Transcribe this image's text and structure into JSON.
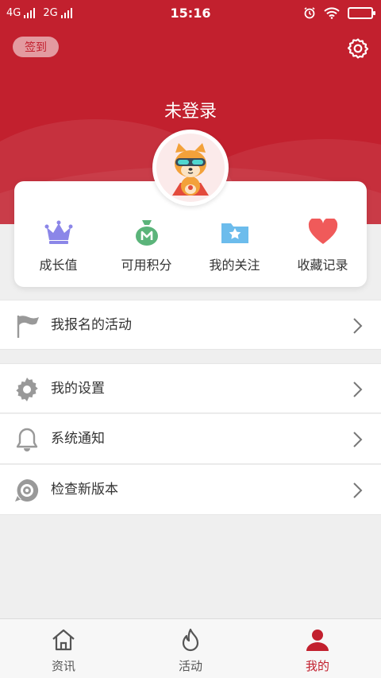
{
  "status_bar": {
    "network1": "4G",
    "network2": "2G",
    "time": "15:16"
  },
  "header": {
    "sign_in_label": "签到",
    "title": "未登录",
    "background_color": "#c2202e"
  },
  "stats": [
    {
      "label": "成长值",
      "icon": "crown-icon",
      "color": "#8b86e8"
    },
    {
      "label": "可用积分",
      "icon": "money-bag-icon",
      "color": "#5bb47a"
    },
    {
      "label": "我的关注",
      "icon": "star-folder-icon",
      "color": "#6cbcec"
    },
    {
      "label": "收藏记录",
      "icon": "heart-icon",
      "color": "#f05a5a"
    }
  ],
  "menu": [
    {
      "label": "我报名的活动",
      "icon": "flag-icon"
    },
    {
      "label": "我的设置",
      "icon": "gear-icon"
    },
    {
      "label": "系统通知",
      "icon": "bell-icon"
    },
    {
      "label": "检查新版本",
      "icon": "target-icon"
    }
  ],
  "tabs": [
    {
      "label": "资讯",
      "icon": "home-icon",
      "active": false
    },
    {
      "label": "活动",
      "icon": "flame-icon",
      "active": false
    },
    {
      "label": "我的",
      "icon": "person-icon",
      "active": true
    }
  ],
  "accent_color": "#c2202e"
}
